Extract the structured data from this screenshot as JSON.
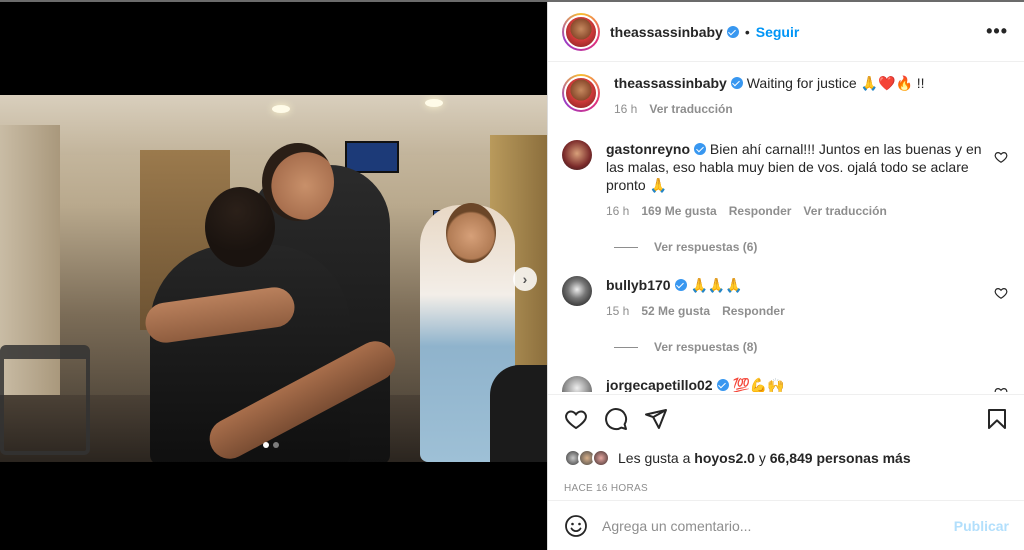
{
  "post": {
    "author": "theassassinbaby",
    "follow_label": "Seguir",
    "separator": "•",
    "more_label": "•••",
    "caption_text": "Waiting for justice 🙏❤️🔥 !!",
    "caption_time": "16 h",
    "caption_translate": "Ver traducción"
  },
  "comments": [
    {
      "user": "gastonreyno",
      "text": "Bien ahí carnal!!! Juntos en las buenas y en las malas, eso habla muy bien de vos. ojalá todo se aclare pronto 🙏",
      "time": "16 h",
      "likes": "169 Me gusta",
      "reply": "Responder",
      "translate": "Ver traducción",
      "replies": "Ver respuestas (6)"
    },
    {
      "user": "bullyb170",
      "text": "🙏🙏🙏",
      "time": "15 h",
      "likes": "52 Me gusta",
      "reply": "Responder",
      "replies": "Ver respuestas (8)"
    },
    {
      "user": "jorgecapetillo02",
      "text": "💯💪🙌"
    }
  ],
  "likes": {
    "prefix": "Les gusta a",
    "first_user": "hoyos2.0",
    "connector": "y",
    "others": "66,849 personas más"
  },
  "timestamp": "HACE 16 HORAS",
  "add_comment": {
    "placeholder": "Agrega un comentario...",
    "post_label": "Publicar"
  },
  "colors": {
    "accent": "#0095f6",
    "verified": "#3897f0",
    "muted": "#8e8e8e",
    "disabled_post": "#b2dffc"
  },
  "carousel": {
    "slides": 2,
    "current": 1
  }
}
